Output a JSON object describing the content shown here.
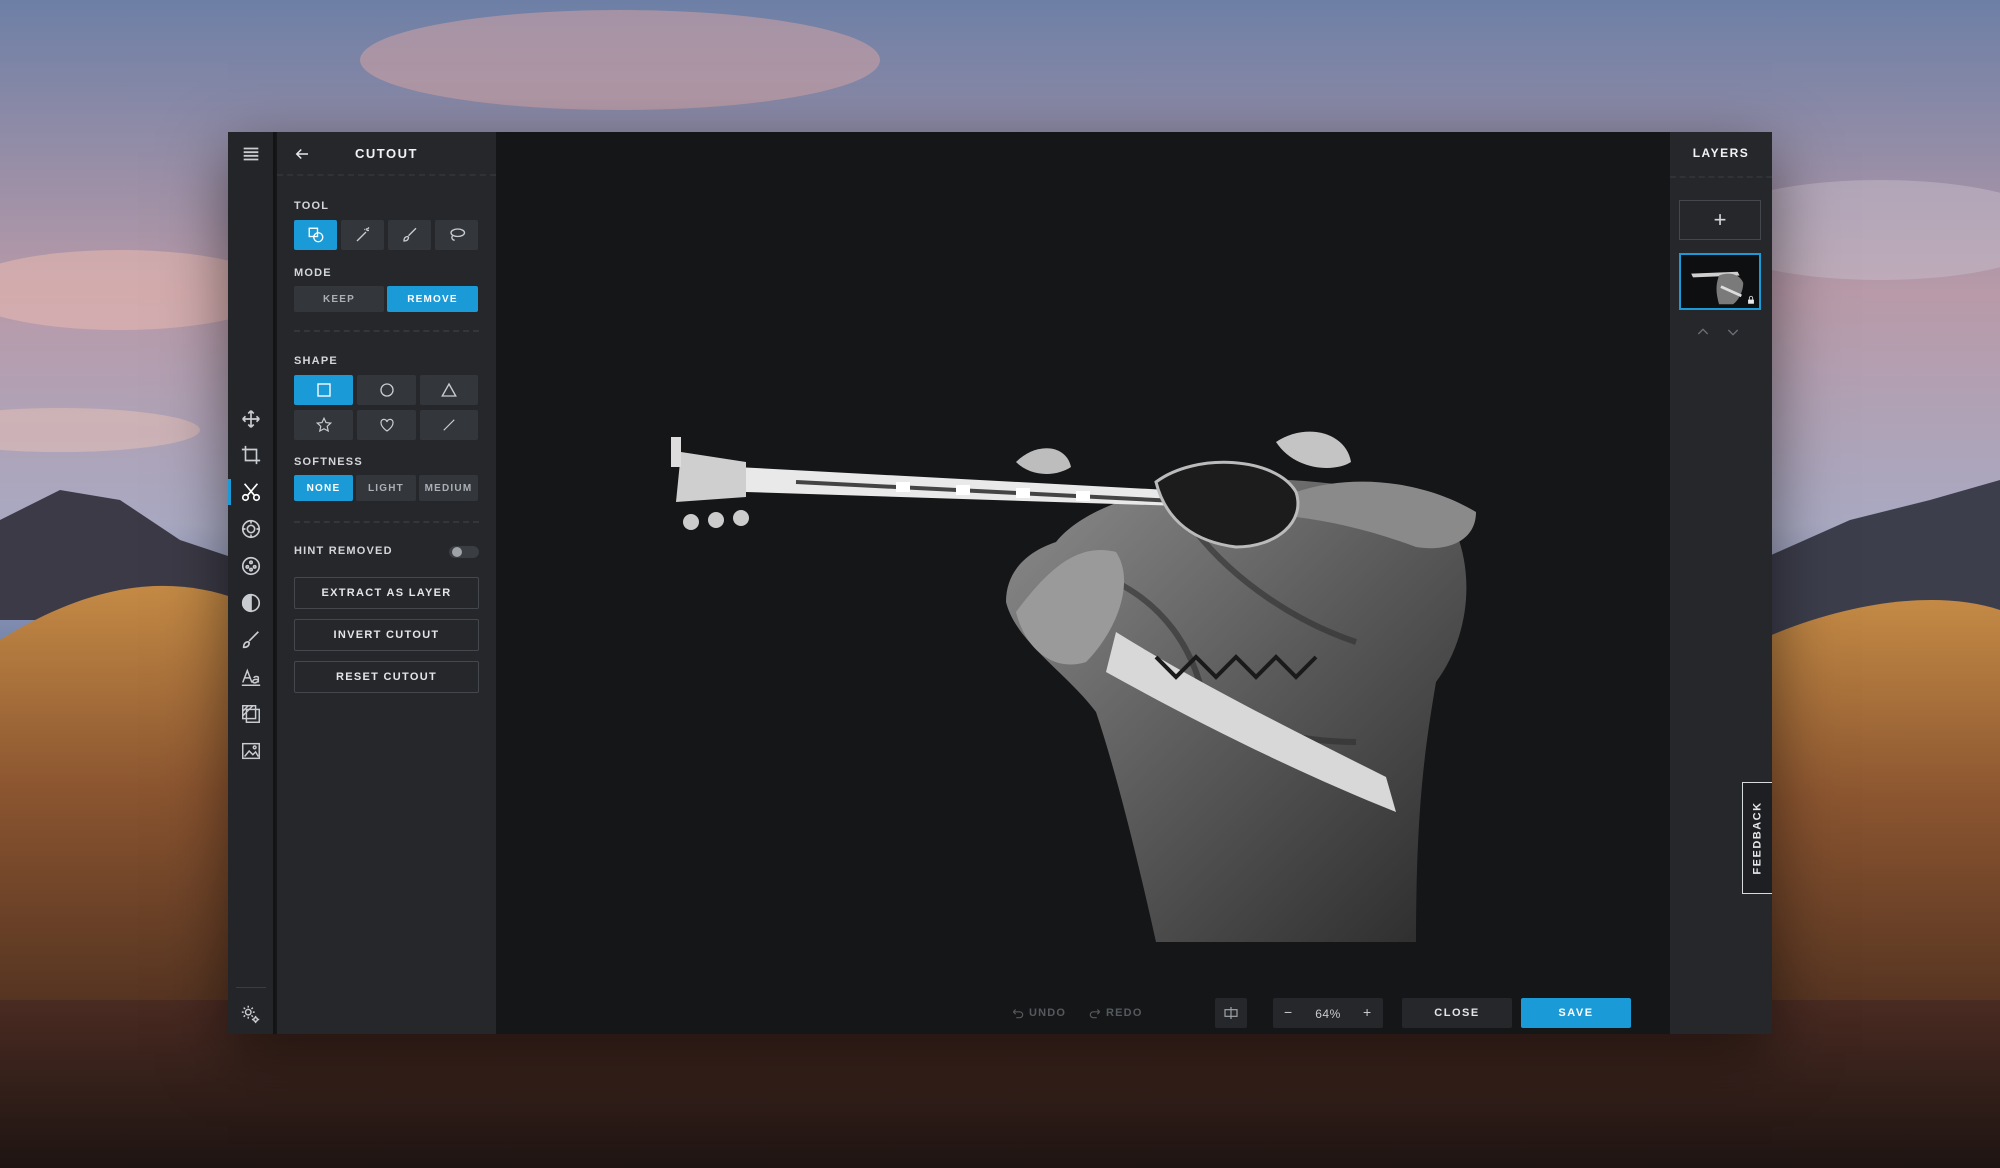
{
  "colors": {
    "accent": "#1a9bd7",
    "panel": "#25272b",
    "canvas": "#151618"
  },
  "iconbar": {
    "items": [
      {
        "icon": "hamburger-menu-icon"
      },
      {
        "icon": "move-icon"
      },
      {
        "icon": "crop-icon"
      },
      {
        "icon": "scissors-icon",
        "active": true
      },
      {
        "icon": "adjust-icon"
      },
      {
        "icon": "effects-icon"
      },
      {
        "icon": "contrast-icon"
      },
      {
        "icon": "brush-icon"
      },
      {
        "icon": "text-icon"
      },
      {
        "icon": "overlay-icon"
      },
      {
        "icon": "image-icon"
      },
      {
        "icon": "settings-icon"
      }
    ]
  },
  "panel": {
    "title": "CUTOUT",
    "tool_label": "TOOL",
    "tools": [
      {
        "icon": "shape-tool-icon",
        "active": true
      },
      {
        "icon": "magic-wand-icon",
        "active": false
      },
      {
        "icon": "brush-icon",
        "active": false
      },
      {
        "icon": "lasso-icon",
        "active": false
      }
    ],
    "mode_label": "MODE",
    "mode_options": [
      "KEEP",
      "REMOVE"
    ],
    "mode_selected": "REMOVE",
    "shape_label": "SHAPE",
    "shapes": [
      {
        "icon": "square-icon",
        "active": true
      },
      {
        "icon": "circle-icon",
        "active": false
      },
      {
        "icon": "triangle-icon",
        "active": false
      },
      {
        "icon": "star-icon",
        "active": false
      },
      {
        "icon": "heart-icon",
        "active": false
      },
      {
        "icon": "line-icon",
        "active": false
      }
    ],
    "softness_label": "SOFTNESS",
    "softness_options": [
      "NONE",
      "LIGHT",
      "MEDIUM"
    ],
    "softness_selected": "NONE",
    "hint_label": "HINT REMOVED",
    "hint_enabled": false,
    "extract_label": "EXTRACT AS LAYER",
    "invert_label": "INVERT CUTOUT",
    "reset_label": "RESET CUTOUT"
  },
  "bottom": {
    "undo_label": "UNDO",
    "redo_label": "REDO",
    "zoom_minus": "−",
    "zoom_value": "64%",
    "zoom_plus": "+",
    "close_label": "CLOSE",
    "save_label": "SAVE"
  },
  "layers": {
    "title": "LAYERS",
    "add_label": "+"
  },
  "feedback_label": "FEEDBACK"
}
